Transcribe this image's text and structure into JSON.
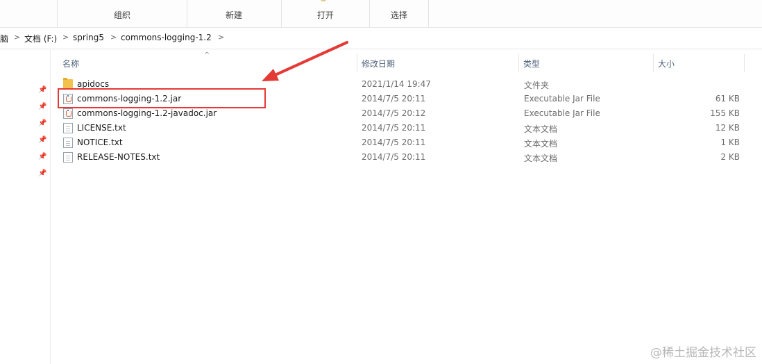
{
  "ribbon": {
    "groups": [
      "组织",
      "新建",
      "打开",
      "选择"
    ]
  },
  "address": {
    "crumbs": [
      "脑",
      "文档 (F:)",
      "spring5",
      "commons-logging-1.2"
    ],
    "separator": ">"
  },
  "columns": {
    "name": "名称",
    "date": "修改日期",
    "type": "类型",
    "size": "大小"
  },
  "files": [
    {
      "name": "apidocs",
      "date": "2021/1/14 19:47",
      "type": "文件夹",
      "size": "",
      "icon": "folder-icon"
    },
    {
      "name": "commons-logging-1.2.jar",
      "date": "2014/7/5 20:11",
      "type": "Executable Jar File",
      "size": "61 KB",
      "icon": "jar-icon"
    },
    {
      "name": "commons-logging-1.2-javadoc.jar",
      "date": "2014/7/5 20:12",
      "type": "Executable Jar File",
      "size": "155 KB",
      "icon": "jar-icon"
    },
    {
      "name": "LICENSE.txt",
      "date": "2014/7/5 20:11",
      "type": "文本文档",
      "size": "12 KB",
      "icon": "text-file-icon"
    },
    {
      "name": "NOTICE.txt",
      "date": "2014/7/5 20:11",
      "type": "文本文档",
      "size": "1 KB",
      "icon": "text-file-icon"
    },
    {
      "name": "RELEASE-NOTES.txt",
      "date": "2014/7/5 20:11",
      "type": "文本文档",
      "size": "2 KB",
      "icon": "text-file-icon"
    }
  ],
  "annotation": {
    "color": "#e53935"
  },
  "watermark": "@稀土掘金技术社区"
}
